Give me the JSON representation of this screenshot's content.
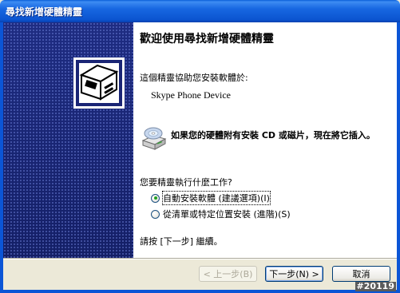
{
  "window": {
    "title": "尋找新增硬體精靈"
  },
  "content": {
    "heading": "歡迎使用尋找新增硬體精靈",
    "intro": "這個精靈協助您安裝軟體於:",
    "device_name": "Skype Phone Device",
    "cd_prompt": "如果您的硬體附有安裝 CD 或磁片，現在將它插入。",
    "question": "您要精靈執行什麼工作?",
    "options": [
      {
        "label": "自動安裝軟體 (建議選項)(I)",
        "checked": true
      },
      {
        "label": "從清單或特定位置安裝 (進階)(S)",
        "checked": false
      }
    ],
    "hint": "請按 [下一步] 繼續。"
  },
  "buttons": {
    "back": "< 上一步(B)",
    "next": "下一步(N) >",
    "cancel": "取消"
  },
  "watermark": "#20119",
  "icons": {
    "wizard": "hardware-wizard-icon",
    "cd": "cd-drive-icon"
  },
  "colors": {
    "titlebar": "#0b55d6",
    "side_panel": "#1b2878",
    "dialog_bg": "#ece9d8"
  }
}
